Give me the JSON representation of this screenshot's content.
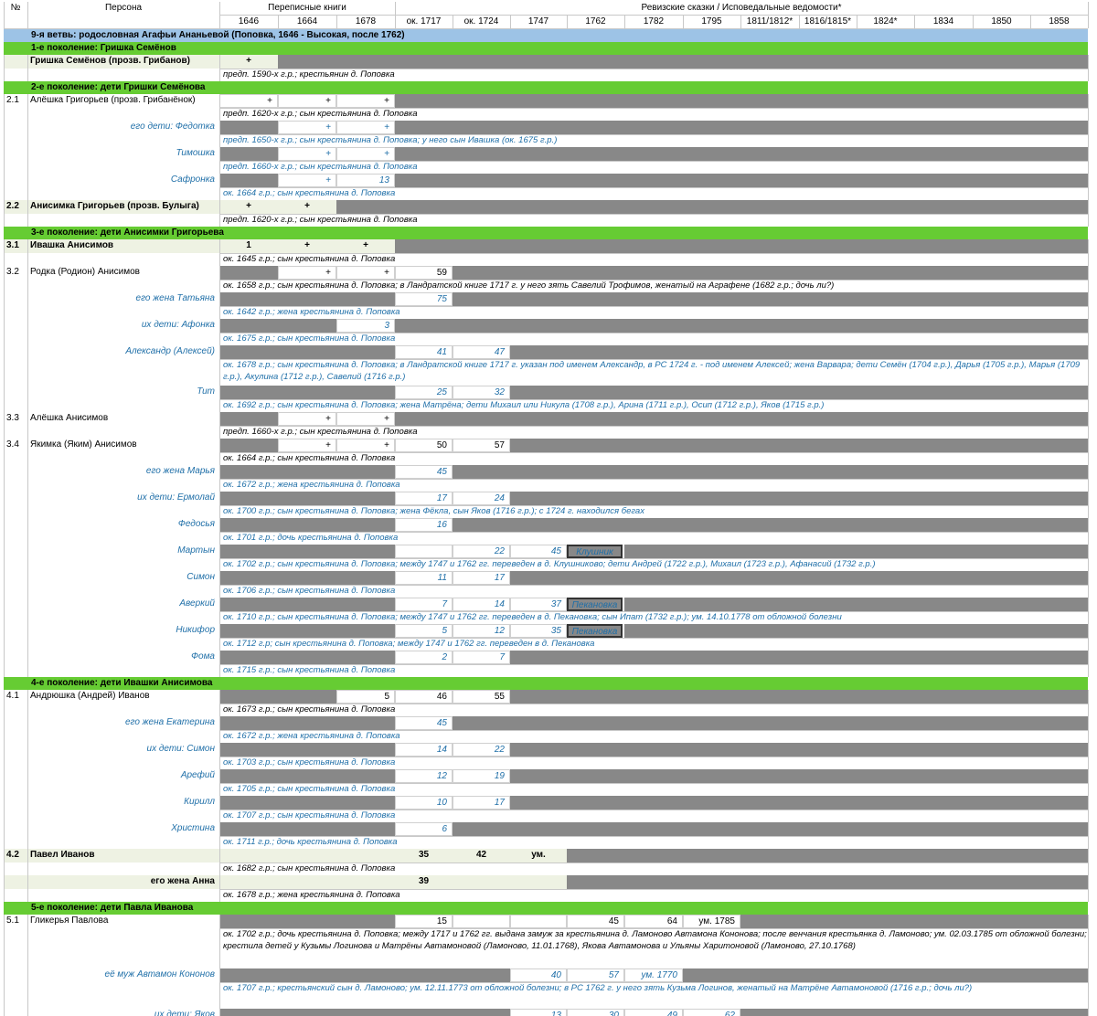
{
  "header": {
    "num": "№",
    "persona": "Персона",
    "census_books": "Переписные книги",
    "revision": "Ревизские сказки / Исповедальные ведомости*",
    "years": [
      "1646",
      "1664",
      "1678",
      "ок. 1717",
      "ок. 1724",
      "1747",
      "1762",
      "1782",
      "1795",
      "1811/1812*",
      "1816/1815*",
      "1824*",
      "1834",
      "1850",
      "1858"
    ]
  },
  "rows": [
    {
      "type": "section",
      "label": "9-я ветвь: родословная Агафьи Ананьевой (Поповка, 1646 - Высокая, после 1762)",
      "color": "teal"
    },
    {
      "type": "section",
      "label": "1-е поколение: Гришка Семёнов",
      "color": "green"
    },
    {
      "type": "person",
      "name": "Гришка Семёнов (прозв. Грибанов)",
      "bold": true,
      "bg": "beige",
      "cells": [
        "+",
        "",
        "",
        "",
        "",
        "",
        "",
        "",
        "",
        "",
        "",
        "",
        "",
        "",
        ""
      ],
      "note": "предп. 1590-х г.р.; крестьянин д. Поповка",
      "gray_from": 1
    },
    {
      "type": "section",
      "label": "2-е поколение: дети Гришки Семёнова",
      "color": "green"
    },
    {
      "type": "person",
      "num": "2.1",
      "name": "Алёшка Григорьев (прозв. Грибанёнок)",
      "cells": [
        "+",
        "+",
        "+"
      ],
      "note": "предп. 1620-х г.р.; сын крестьянина д. Поповка",
      "gray_from": 3
    },
    {
      "type": "person",
      "name": "его дети: Федотка",
      "blue": true,
      "cells": [
        "",
        "+",
        "+"
      ],
      "gray_cells": [
        0
      ],
      "note": "предп. 1650-х г.р.; сын крестьянина д. Поповка; у него сын Ивашка (ок. 1675 г.р.)",
      "gray_from": 3
    },
    {
      "type": "person",
      "name": "Тимошка",
      "blue": true,
      "cells": [
        "",
        "+",
        "+"
      ],
      "gray_cells": [
        0
      ],
      "note": "предп. 1660-х г.р.; сын крестьянина д. Поповка",
      "gray_from": 3
    },
    {
      "type": "person",
      "name": "Сафронка",
      "blue": true,
      "cells": [
        "",
        "+",
        "13"
      ],
      "gray_cells": [
        0
      ],
      "note": "ок. 1664 г.р.; сын крестьянина д. Поповка",
      "gray_from": 3
    },
    {
      "type": "person",
      "num": "2.2",
      "name": "Анисимка Григорьев (прозв. Булыга)",
      "bold": true,
      "bg": "beige",
      "cells": [
        "+",
        "+"
      ],
      "note": "предп. 1620-х г.р.; сын крестьянина д. Поповка",
      "gray_from": 2
    },
    {
      "type": "section",
      "label": "3-е поколение: дети Анисимки Григорьева",
      "color": "green"
    },
    {
      "type": "person",
      "num": "3.1",
      "name": "Ивашка Анисимов",
      "bold": true,
      "bg": "beige",
      "cells": [
        "1",
        "+",
        "+"
      ],
      "note": "ок. 1645 г.р.; сын крестьянина д. Поповка",
      "gray_from": 3
    },
    {
      "type": "person",
      "num": "3.2",
      "name": "Родка (Родион) Анисимов",
      "cells": [
        "",
        "+",
        "+",
        "59"
      ],
      "gray_cells": [
        0
      ],
      "note": "ок. 1658 г.р.; сын крестьянина д. Поповка; в Ландратской книге 1717 г. у него зять Савелий Трофимов, женатый на Аграфене (1682 г.р.; дочь ли?)",
      "gray_from": 4
    },
    {
      "type": "person",
      "name": "его жена Татьяна",
      "blue": true,
      "cells": [
        "",
        "",
        "",
        "75"
      ],
      "gray_cells": [
        0,
        1,
        2
      ],
      "note": "ок. 1642 г.р.; жена крестьянина д. Поповка",
      "gray_from": 4
    },
    {
      "type": "person",
      "name": "их дети: Афонка",
      "blue": true,
      "cells": [
        "",
        "",
        "3"
      ],
      "gray_cells": [
        0,
        1
      ],
      "note": "ок. 1675 г.р.; сын крестьянина д. Поповка",
      "gray_from": 3
    },
    {
      "type": "person",
      "name": "Александр (Алексей)",
      "blue": true,
      "cells": [
        "",
        "",
        "",
        "41",
        "47"
      ],
      "gray_cells": [
        0,
        1,
        2
      ],
      "note": "ок. 1678 г.р.; сын крестьянина д. Поповка; в Ландратской книге 1717 г. указан под именем Александр, в РС 1724 г. - под именем Алексей; жена Варвара; дети Семён (1704 г.р.), Дарья (1705 г.р.), Марья (1709 г.р.), Акулина (1712 г.р.), Савелий (1716 г.р.)",
      "gray_from": 5,
      "tall": true
    },
    {
      "type": "person",
      "name": "Тит",
      "blue": true,
      "cells": [
        "",
        "",
        "",
        "25",
        "32"
      ],
      "gray_cells": [
        0,
        1,
        2
      ],
      "note": "ок. 1692 г.р.; сын крестьянина д. Поповка; жена Матрёна; дети Михаил или Никула (1708 г.р.), Арина (1711 г.р.), Осип (1712 г.р.), Яков (1715 г.р.)",
      "gray_from": 5
    },
    {
      "type": "person",
      "num": "3.3",
      "name": "Алёшка Анисимов",
      "cells": [
        "",
        "+",
        "+"
      ],
      "gray_cells": [
        0
      ],
      "note": "предп. 1660-х г.р.; сын крестьянина д. Поповка",
      "gray_from": 3
    },
    {
      "type": "person",
      "num": "3.4",
      "name": "Якимка (Яким) Анисимов",
      "cells": [
        "",
        "+",
        "+",
        "50",
        "57"
      ],
      "gray_cells": [
        0
      ],
      "note": "ок. 1664 г.р.; сын крестьянина д. Поповка",
      "gray_from": 5
    },
    {
      "type": "person",
      "name": "его жена Марья",
      "blue": true,
      "cells": [
        "",
        "",
        "",
        "45"
      ],
      "gray_cells": [
        0,
        1,
        2
      ],
      "note": "ок. 1672 г.р.; жена крестьянина д. Поповка",
      "gray_from": 4
    },
    {
      "type": "person",
      "name": "их дети: Ермолай",
      "blue": true,
      "cells": [
        "",
        "",
        "",
        "17",
        "24"
      ],
      "gray_cells": [
        0,
        1,
        2
      ],
      "note": "ок. 1700 г.р.; сын крестьянина д. Поповка; жена Фёкла, сын Яков (1716 г.р.); с 1724 г. находился бегах",
      "gray_from": 5
    },
    {
      "type": "person",
      "name": "Федосья",
      "blue": true,
      "cells": [
        "",
        "",
        "",
        "16"
      ],
      "gray_cells": [
        0,
        1,
        2
      ],
      "note": "ок. 1701 г.р.; дочь крестьянина д. Поповка",
      "gray_from": 4
    },
    {
      "type": "person",
      "name": "Мартын",
      "blue": true,
      "cells": [
        "",
        "",
        "",
        "",
        "22",
        "45",
        "Клушник"
      ],
      "gray_cells": [
        0,
        1,
        2
      ],
      "boxed": 6,
      "note": "ок. 1702 г.р.; сын крестьянина д. Поповка; между 1747 и 1762 гг. переведен в д. Клушниково; дети Андрей (1722 г.р.), Михаил (1723 г.р.), Афанасий (1732 г.р.)",
      "gray_from": 7
    },
    {
      "type": "person",
      "name": "Симон",
      "blue": true,
      "cells": [
        "",
        "",
        "",
        "11",
        "17"
      ],
      "gray_cells": [
        0,
        1,
        2
      ],
      "note": "ок. 1706 г.р.; сын крестьянина д. Поповка",
      "gray_from": 5
    },
    {
      "type": "person",
      "name": "Аверкий",
      "blue": true,
      "cells": [
        "",
        "",
        "",
        "7",
        "14",
        "37",
        "Пекановка"
      ],
      "gray_cells": [
        0,
        1,
        2
      ],
      "boxed": 6,
      "note": "ок. 1710 г.р.; сын крестьянина д. Поповка; между 1747 и 1762 гг. переведен в д. Пекановка; сын Ипат (1732 г.р.); ум. 14.10.1778 от обложной болезни",
      "gray_from": 7
    },
    {
      "type": "person",
      "name": "Никифор",
      "blue": true,
      "cells": [
        "",
        "",
        "",
        "5",
        "12",
        "35",
        "Пекановка"
      ],
      "gray_cells": [
        0,
        1,
        2
      ],
      "boxed": 6,
      "note": "ок. 1712 г.р; сын крестьянина д. Поповка; между 1747 и 1762 гг. переведен в д. Пекановка",
      "gray_from": 7
    },
    {
      "type": "person",
      "name": "Фома",
      "blue": true,
      "cells": [
        "",
        "",
        "",
        "2",
        "7"
      ],
      "gray_cells": [
        0,
        1,
        2
      ],
      "note": "ок. 1715 г.р.; сын крестьянина д. Поповка",
      "gray_from": 5
    },
    {
      "type": "section",
      "label": "4-е поколение: дети Ивашки Анисимова",
      "color": "green"
    },
    {
      "type": "person",
      "num": "4.1",
      "name": "Андрюшка (Андрей) Иванов",
      "cells": [
        "",
        "",
        "5",
        "46",
        "55"
      ],
      "gray_cells": [
        0,
        1
      ],
      "note": "ок. 1673 г.р.; сын крестьянина д. Поповка",
      "gray_from": 5
    },
    {
      "type": "person",
      "name": "его жена Екатерина",
      "blue": true,
      "cells": [
        "",
        "",
        "",
        "45"
      ],
      "gray_cells": [
        0,
        1,
        2
      ],
      "note": "ок. 1672 г.р.; жена крестьянина д. Поповка",
      "gray_from": 4
    },
    {
      "type": "person",
      "name": "их дети: Симон",
      "blue": true,
      "cells": [
        "",
        "",
        "",
        "14",
        "22"
      ],
      "gray_cells": [
        0,
        1,
        2
      ],
      "note": "ок. 1703 г.р.; сын крестьянина д. Поповка",
      "gray_from": 5
    },
    {
      "type": "person",
      "name": "Арефий",
      "blue": true,
      "cells": [
        "",
        "",
        "",
        "12",
        "19"
      ],
      "gray_cells": [
        0,
        1,
        2
      ],
      "note": "ок. 1705 г.р.; сын крестьянина д. Поповка",
      "gray_from": 5
    },
    {
      "type": "person",
      "name": "Кирилл",
      "blue": true,
      "cells": [
        "",
        "",
        "",
        "10",
        "17"
      ],
      "gray_cells": [
        0,
        1,
        2
      ],
      "note": "ок. 1707 г.р.; сын крестьянина д. Поповка",
      "gray_from": 5
    },
    {
      "type": "person",
      "name": "Христина",
      "blue": true,
      "cells": [
        "",
        "",
        "",
        "6"
      ],
      "gray_cells": [
        0,
        1,
        2
      ],
      "note": "ок. 1711 г.р.; дочь крестьянина д. Поповка",
      "gray_from": 4
    },
    {
      "type": "person",
      "num": "4.2",
      "name": "Павел Иванов",
      "bold": true,
      "bg": "beige",
      "cells": [
        "",
        "",
        "",
        "35",
        "42",
        "ум."
      ],
      "note": "ок. 1682 г.р.; сын крестьянина д. Поповка",
      "gray_from": 6
    },
    {
      "type": "person",
      "name": "его жена Анна",
      "bold": true,
      "bg": "beige",
      "right": true,
      "cells": [
        "",
        "",
        "",
        "39"
      ],
      "note": "ок. 1678 г.р.; жена крестьянина д. Поповка",
      "gray_from": 6
    },
    {
      "type": "section",
      "label": "5-е поколение: дети Павла Иванова",
      "color": "green"
    },
    {
      "type": "person",
      "num": "5.1",
      "name": "Гликерья Павлова",
      "cells": [
        "",
        "",
        "",
        "15",
        "",
        "",
        "45",
        "64",
        "ум. 1785"
      ],
      "gray_cells": [
        0,
        1,
        2
      ],
      "note": "ок. 1702 г.р.; дочь крестьянина д. Поповка; между 1717 и 1762 гг. выдана замуж за крестьянина д. Ламоново Автамона Кононова; после венчания крестьянка д. Ламоново; ум. 02.03.1785 от обложной болезни; крестила детей у Кузьмы Логинова и Матрёны Автамоновой (Ламоново, 11.01.1768), Якова Автамонова и Ульяны Харитоновой (Ламоново, 27.10.1768)",
      "gray_from": 9,
      "tall2": true
    },
    {
      "type": "person",
      "name": "её муж Автамон Кононов",
      "blue": true,
      "cells": [
        "",
        "",
        "",
        "",
        "",
        "40",
        "57",
        "ум. 1770"
      ],
      "gray_cells": [
        0,
        1,
        2,
        3,
        4
      ],
      "note": "ок. 1707 г.р.; крестьянский сын д. Ламоново; ум. 12.11.1773 от обложной болезни; в РС 1762 г. у него зять Кузьма Логинов, женатый на Матрёне Автамоновой (1716 г.р.; дочь ли?)",
      "gray_from": 8,
      "tall": true
    },
    {
      "type": "person",
      "name": "их дети: Яков",
      "blue": true,
      "cells": [
        "",
        "",
        "",
        "",
        "",
        "13",
        "30",
        "49",
        "62"
      ],
      "gray_cells": [
        0,
        1,
        2,
        3,
        4
      ],
      "note": "",
      "gray_from": 9
    }
  ]
}
